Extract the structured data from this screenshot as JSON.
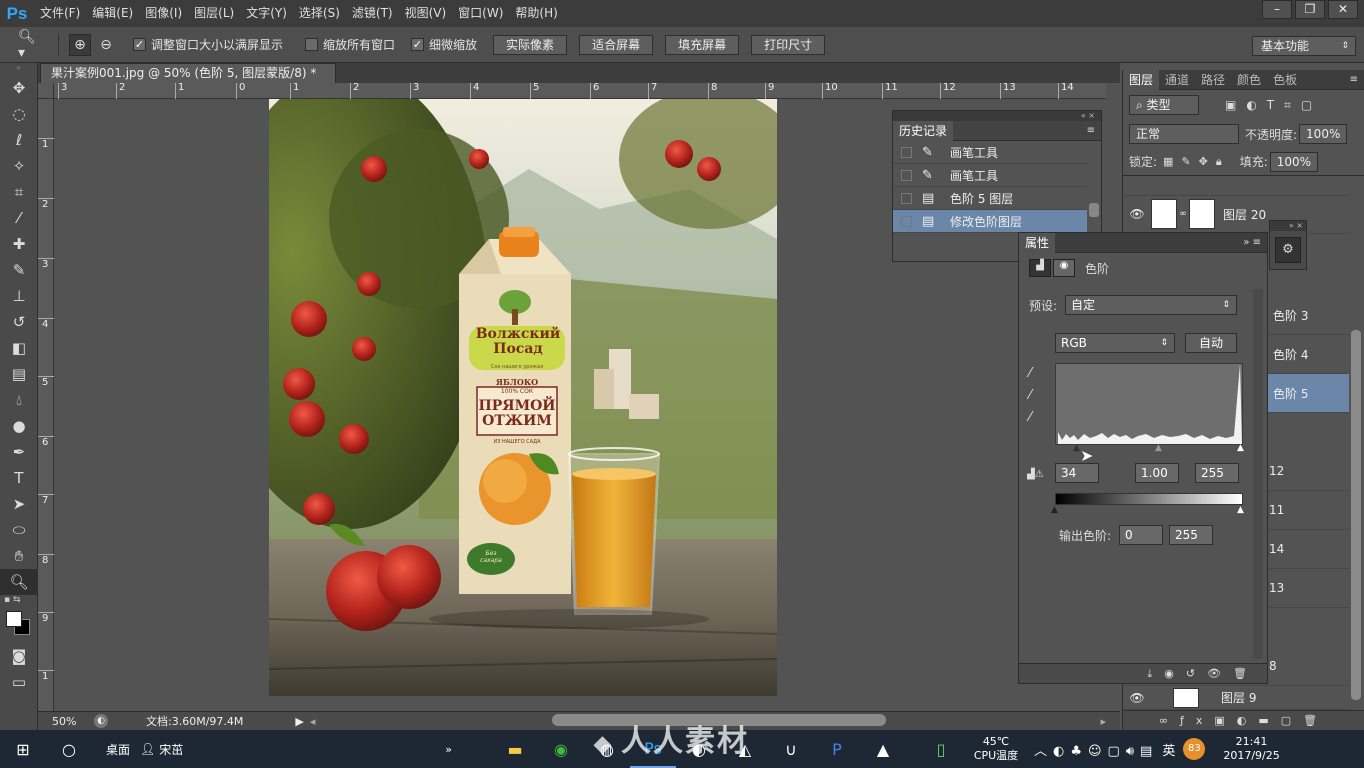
{
  "app": {
    "logo": "Ps"
  },
  "menu": [
    "文件(F)",
    "编辑(E)",
    "图像(I)",
    "图层(L)",
    "文字(Y)",
    "选择(S)",
    "滤镜(T)",
    "视图(V)",
    "窗口(W)",
    "帮助(H)"
  ],
  "window_controls": [
    "–",
    "❐",
    "✕"
  ],
  "options": {
    "resize_windows": "调整窗口大小以满屏显示",
    "zoom_all": "缩放所有窗口",
    "scrubby_zoom": "细微缩放",
    "actual_pixels": "实际像素",
    "fit_screen": "适合屏幕",
    "fill_screen": "填充屏幕",
    "print_size": "打印尺寸",
    "workspace": "基本功能"
  },
  "document": {
    "tab_title": "果汁案例001.jpg @ 50% (色阶 5, 图层蒙版/8) *",
    "ruler_top": [
      "3",
      "2",
      "1",
      "0",
      "1",
      "2",
      "3",
      "4",
      "5",
      "6",
      "7",
      "8",
      "9",
      "10",
      "11",
      "12",
      "13",
      "14"
    ],
    "ruler_left": [
      "1",
      "2",
      "3",
      "4",
      "5",
      "6",
      "7",
      "8",
      "9",
      "1"
    ],
    "zoom": "50%",
    "doc_size": "文档:3.60M/97.4M"
  },
  "product": {
    "brand_line1": "Волжский",
    "brand_line2": "Посад",
    "tagline": "Сок нашего урожая",
    "fruit": "ЯБЛОКО",
    "juice": "100% СОК",
    "name_line1": "ПРЯМОЙ",
    "name_line2": "ОТЖИМ",
    "sub": "ИЗ НАШЕГО САДА",
    "badge1": "Без",
    "badge2": "сахара"
  },
  "history": {
    "tab": "历史记录",
    "items": [
      {
        "label": "画笔工具",
        "icon": "brush-icon",
        "selected": false
      },
      {
        "label": "画笔工具",
        "icon": "brush-icon",
        "selected": false
      },
      {
        "label": "色阶 5 图层",
        "icon": "document-icon",
        "selected": false
      },
      {
        "label": "修改色阶图层",
        "icon": "document-icon",
        "selected": true
      }
    ]
  },
  "layers_panel": {
    "tabs": [
      "图层",
      "通道",
      "路径",
      "颜色",
      "色板"
    ],
    "filter_kind": "类型",
    "blend_mode": "正常",
    "opacity_label": "不透明度:",
    "opacity": "100%",
    "lock_label": "锁定:",
    "fill_label": "填充:",
    "fill": "100%",
    "layers": [
      {
        "name": "图层 20",
        "selected": false
      },
      {
        "name": "色阶 3",
        "selected": false
      },
      {
        "name": "色阶 4",
        "selected": false
      },
      {
        "name": "色阶 5",
        "selected": true
      },
      {
        "name": "12",
        "selected": false
      },
      {
        "name": "11",
        "selected": false
      },
      {
        "name": "14",
        "selected": false
      },
      {
        "name": "13",
        "selected": false
      },
      {
        "name": "8",
        "selected": false
      },
      {
        "name": "图层 9",
        "selected": false
      }
    ]
  },
  "properties": {
    "tab": "属性",
    "title": "色阶",
    "preset_label": "预设:",
    "preset": "自定",
    "channel": "RGB",
    "auto": "自动",
    "input_black": "34",
    "input_gamma": "1.00",
    "input_white": "255",
    "output_label": "输出色阶:",
    "output_black": "0",
    "output_white": "255"
  },
  "taskbar": {
    "desktop": "桌面",
    "user": "宋茁",
    "temp": "45℃",
    "temp_label": "CPU温度",
    "lang": "英",
    "battery": "83",
    "time": "21:41",
    "date": "2017/9/25",
    "watermark": "人人素材"
  },
  "colors": {
    "accent_selected": "#6a86a8",
    "ps_blue": "#31a8ff"
  }
}
